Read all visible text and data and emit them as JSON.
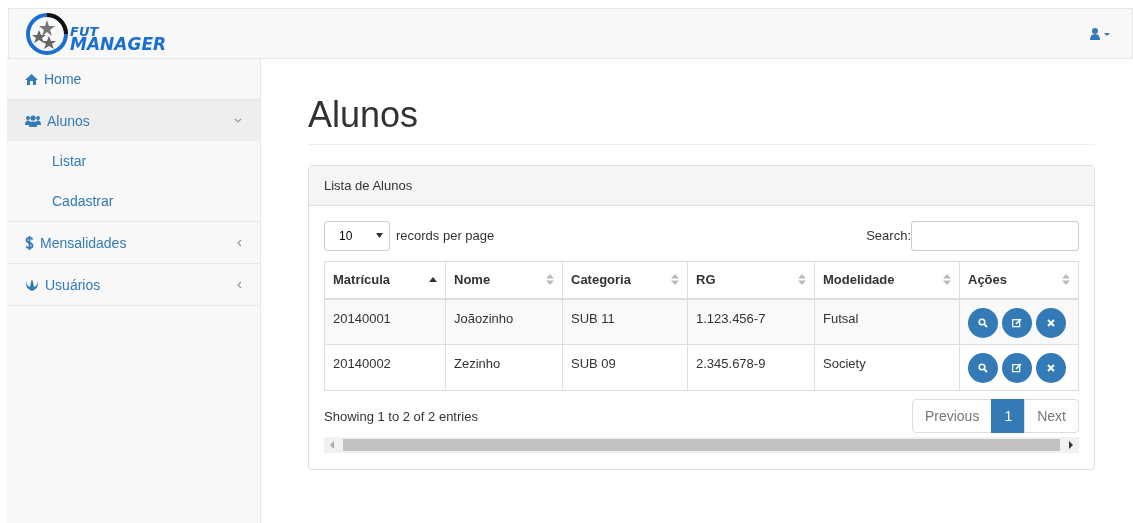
{
  "navbar": {
    "brand": {
      "line_1": "FUT",
      "line_2": "MANAGER"
    }
  },
  "sidebar": {
    "items": [
      {
        "label": "Home",
        "kind": "link"
      },
      {
        "label": "Alunos",
        "kind": "menu",
        "expanded": true,
        "children": [
          {
            "label": "Listar"
          },
          {
            "label": "Cadastrar"
          }
        ]
      },
      {
        "label": "Mensalidades",
        "kind": "menu",
        "expanded": false
      },
      {
        "label": "Usuários",
        "kind": "menu",
        "expanded": false
      }
    ]
  },
  "page_title": "Alunos",
  "panel": {
    "title": "Lista de Alunos",
    "length_select": {
      "value": "10",
      "label": "records per page"
    },
    "search": {
      "label": "Search:"
    },
    "table": {
      "columns": [
        {
          "label": "Matrícula",
          "sorted": true
        },
        {
          "label": "Nome",
          "sorted": false
        },
        {
          "label": "Categoria",
          "sorted": false
        },
        {
          "label": "RG",
          "sorted": false
        },
        {
          "label": "Modelidade",
          "sorted": false
        },
        {
          "label": "Ações",
          "sorted": false
        }
      ],
      "rows": [
        {
          "cells": [
            "20140001",
            "Joãozinho",
            "SUB 11",
            "1.123.456-7",
            "Futsal"
          ]
        },
        {
          "cells": [
            "20140002",
            "Zezinho",
            "SUB 09",
            "2.345.678-9",
            "Society"
          ]
        }
      ]
    },
    "info": "Showing 1 to 2 of 2 entries",
    "pagination": [
      {
        "label": "Previous",
        "selected": false
      },
      {
        "label": "1",
        "selected": true
      },
      {
        "label": "Next",
        "selected": false
      }
    ]
  }
}
